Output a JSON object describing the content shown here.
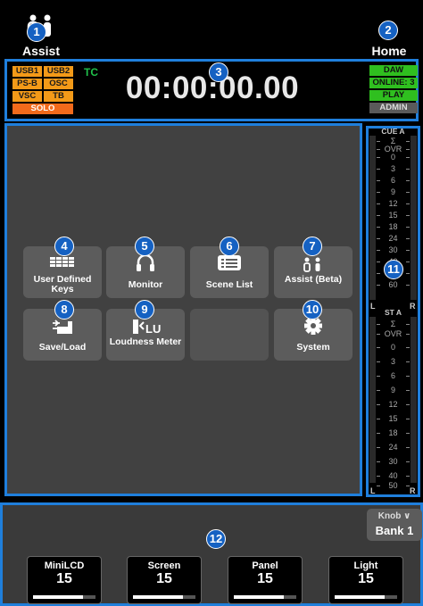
{
  "topbar": {
    "assist_label": "Assist",
    "home_label": "Home"
  },
  "badges": [
    "1",
    "2",
    "3",
    "4",
    "5",
    "6",
    "7",
    "8",
    "9",
    "10",
    "11",
    "12"
  ],
  "status": {
    "sources": [
      {
        "label": "USB1"
      },
      {
        "label": "USB2"
      },
      {
        "label": "PS-B"
      },
      {
        "label": "OSC"
      },
      {
        "label": "VSC"
      },
      {
        "label": "TB"
      },
      {
        "label": "SOLO"
      }
    ],
    "tc_label": "TC",
    "timecode": "00:00:00.00",
    "right": [
      {
        "label": "DAW"
      },
      {
        "label": "ONLINE: 3"
      },
      {
        "label": "PLAY"
      },
      {
        "label": "ADMIN"
      }
    ]
  },
  "tiles": [
    {
      "label": "User Defined Keys",
      "icon": "keyboard-grid-icon"
    },
    {
      "label": "Monitor",
      "icon": "headphones-icon"
    },
    {
      "label": "Scene List",
      "icon": "list-icon"
    },
    {
      "label": "Assist (Beta)",
      "icon": "assist-people-icon"
    },
    {
      "label": "Save/Load",
      "icon": "save-load-icon"
    },
    {
      "label": "Loudness Meter",
      "icon": "loudness-icon"
    },
    {
      "label": "",
      "icon": ""
    },
    {
      "label": "System",
      "icon": "gear-icon"
    }
  ],
  "meters": {
    "cue_title": "CUE A",
    "st_title": "ST A",
    "sum": "Σ",
    "ovr": "OVR",
    "cue_scale": [
      "0",
      "3",
      "6",
      "9",
      "12",
      "15",
      "18",
      "24",
      "30",
      "40",
      "50",
      "60"
    ],
    "st_scale": [
      "0",
      "3",
      "6",
      "9",
      "12",
      "15",
      "18",
      "24",
      "30",
      "40",
      "50",
      "60"
    ],
    "left": "L",
    "right": "R"
  },
  "bottom": {
    "knob_label": "Knob",
    "bank_label": "Bank 1",
    "knobs": [
      {
        "label": "MiniLCD",
        "value": "15",
        "level": 0.8
      },
      {
        "label": "Screen",
        "value": "15",
        "level": 0.8
      },
      {
        "label": "Panel",
        "value": "15",
        "level": 0.8
      },
      {
        "label": "Light",
        "value": "15",
        "level": 0.8
      }
    ]
  },
  "colors": {
    "accent": "#1f7fdc",
    "badge": "#1561c2",
    "source": "#f39a18",
    "solo": "#f26a1b",
    "online": "#2fbf1f"
  }
}
